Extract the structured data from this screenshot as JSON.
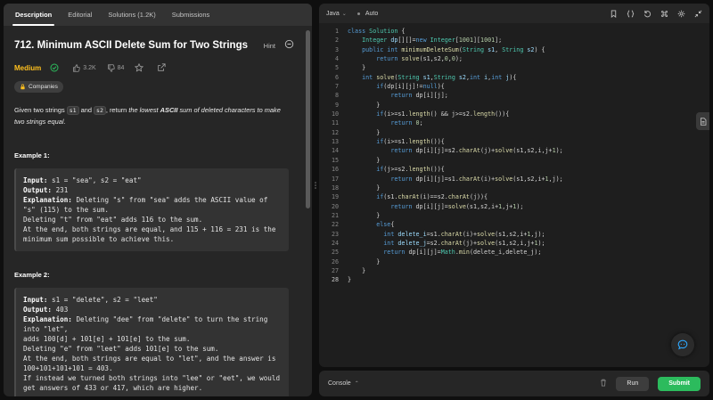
{
  "tabs": [
    "Description",
    "Editorial",
    "Solutions (1.2K)",
    "Submissions"
  ],
  "problem": {
    "title": "712. Minimum ASCII Delete Sum for Two Strings",
    "hint": "Hint",
    "difficulty": "Medium",
    "likes": "3.2K",
    "dislikes": "84",
    "companies": "Companies",
    "desc": {
      "p1": "Given two strings ",
      "s1": "s1",
      "p2": " and ",
      "s2": "s2",
      "p3": ", return ",
      "em1": "the lowest ",
      "bold": "ASCII",
      "em2": " sum of deleted characters to make two strings equal",
      "p4": "."
    }
  },
  "examples": [
    {
      "title": "Example 1:",
      "input_label": "Input:",
      "input": " s1 = \"sea\", s2 = \"eat\"",
      "output_label": "Output:",
      "output": " 231",
      "expl_label": "Explanation:",
      "expl": " Deleting \"s\" from \"sea\" adds the ASCII value of \"s\" (115) to the sum.\nDeleting \"t\" from \"eat\" adds 116 to the sum.\nAt the end, both strings are equal, and 115 + 116 = 231 is the minimum sum possible to achieve this."
    },
    {
      "title": "Example 2:",
      "input_label": "Input:",
      "input": " s1 = \"delete\", s2 = \"leet\"",
      "output_label": "Output:",
      "output": " 403",
      "expl_label": "Explanation:",
      "expl": " Deleting \"dee\" from \"delete\" to turn the string into \"let\",\nadds 100[d] + 101[e] + 101[e] to the sum.\nDeleting \"e\" from \"leet\" adds 101[e] to the sum.\nAt the end, both strings are equal to \"let\", and the answer is 100+101+101+101 = 403.\nIf instead we turned both strings into \"lee\" or \"eet\", we would get answers of 433 or 417, which are higher."
    }
  ],
  "editor": {
    "language": "Java",
    "mode": "Auto",
    "current_line": "28",
    "lines": [
      "1",
      "2",
      "3",
      "4",
      "5",
      "6",
      "7",
      "8",
      "9",
      "10",
      "11",
      "12",
      "13",
      "14",
      "15",
      "16",
      "17",
      "18",
      "19",
      "20",
      "21",
      "22",
      "23",
      "24",
      "25",
      "26",
      "27",
      "28"
    ]
  },
  "console": {
    "label": "Console",
    "run": "Run",
    "submit": "Submit"
  },
  "colors": {
    "medium": "#ffc01e",
    "submit": "#2cbb5d"
  }
}
